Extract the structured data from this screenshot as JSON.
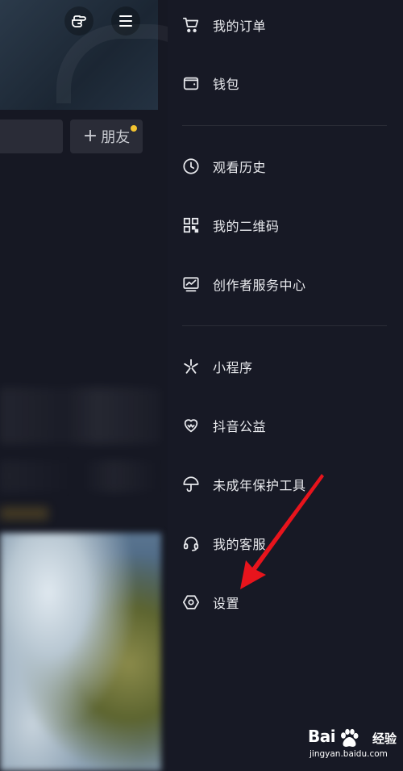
{
  "left_panel": {
    "friend_button_label": "朋友",
    "friend_plus": "+",
    "accent_dot_color": "#f3c430"
  },
  "drawer": {
    "items": [
      {
        "label": "我的订单",
        "icon": "cart-icon"
      },
      {
        "label": "钱包",
        "icon": "wallet-icon"
      },
      {
        "label": "观看历史",
        "icon": "clock-icon"
      },
      {
        "label": "我的二维码",
        "icon": "qrcode-icon"
      },
      {
        "label": "创作者服务中心",
        "icon": "chart-icon"
      },
      {
        "label": "小程序",
        "icon": "mini-program-icon"
      },
      {
        "label": "抖音公益",
        "icon": "charity-heart-icon"
      },
      {
        "label": "未成年保护工具",
        "icon": "umbrella-icon"
      },
      {
        "label": "我的客服",
        "icon": "headset-icon"
      },
      {
        "label": "设置",
        "icon": "settings-hexagon-icon"
      }
    ]
  },
  "annotation": {
    "arrow_color": "#e8141c"
  },
  "watermark": {
    "brand_left": "Bai",
    "brand_right": "经验",
    "url": "jingyan.baidu.com"
  }
}
